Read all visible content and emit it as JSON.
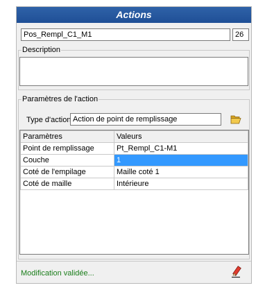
{
  "window": {
    "title": "Actions"
  },
  "action_name": {
    "value": "Pos_Rempl_C1_M1",
    "number": "26"
  },
  "description": {
    "legend": "Description",
    "value": ""
  },
  "params_group": {
    "legend": "Paramètres de l'action"
  },
  "action_type": {
    "label": "Type d'action",
    "value": "Action de point de remplissage",
    "open_icon": "folder-open-icon"
  },
  "table": {
    "headers": [
      "Paramètres",
      "Valeurs"
    ],
    "rows": [
      {
        "param": "Point de remplissage",
        "value": "Pt_Rempl_C1-M1"
      },
      {
        "param": "Couche",
        "value": "1"
      },
      {
        "param": "Coté de l'empilage",
        "value": "Maille coté 1"
      },
      {
        "param": "Coté de maille",
        "value": "Intérieure"
      }
    ]
  },
  "status": {
    "text": "Modification validée..."
  },
  "edit_icon": "pencil-icon",
  "colors": {
    "title_bar": "#1f4f96",
    "selection": "#3399ff",
    "status_text": "#1a7d1a"
  }
}
